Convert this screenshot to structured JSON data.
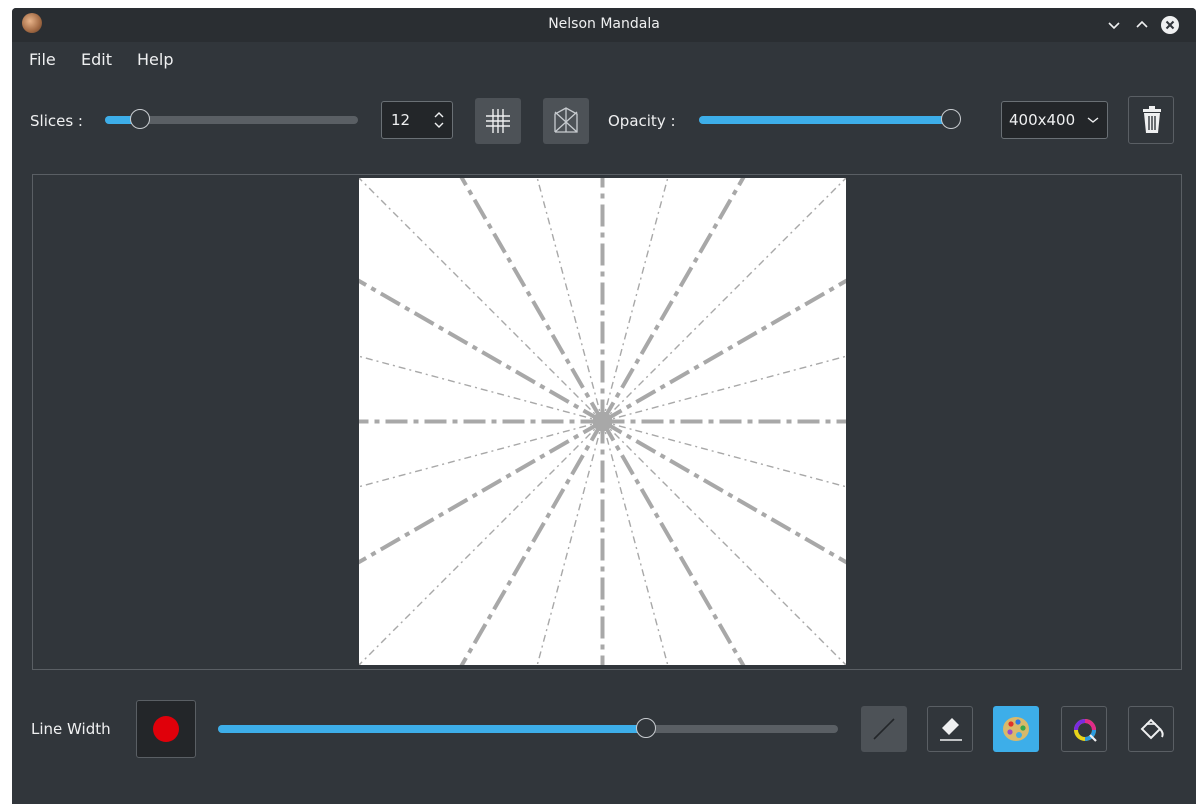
{
  "window": {
    "title": "Nelson Mandala"
  },
  "menu": {
    "items": [
      "File",
      "Edit",
      "Help"
    ]
  },
  "toolbar": {
    "slices_label": "Slices :",
    "slices_value": "12",
    "slices_slider_fraction": 0.14,
    "opacity_label": "Opacity :",
    "opacity_slider_fraction": 1.0,
    "size_selected": "400x400"
  },
  "bottom": {
    "line_width_label": "Line Width",
    "line_width_slider_fraction": 0.69,
    "current_color": "#e0000a"
  },
  "colors": {
    "accent": "#3daee9",
    "background": "#31363b",
    "guide_lines": "#a8a8a8"
  },
  "icons": {
    "grid_toggle": "grid-icon",
    "mirror_toggle": "mirror-icon",
    "clear": "trash-icon",
    "line_tool": "line-icon",
    "eraser_tool": "eraser-icon",
    "palette": "palette-icon",
    "color_wheel": "color-wheel-icon",
    "fill_tool": "bucket-icon"
  }
}
